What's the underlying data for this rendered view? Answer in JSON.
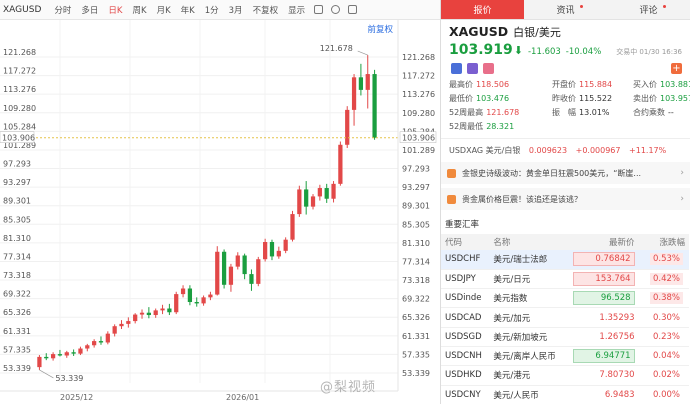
{
  "toolbar": {
    "symbol": "XAGUSD",
    "periods": [
      "分时",
      "多日",
      "日K",
      "周K",
      "月K",
      "年K",
      "1分",
      "3月",
      "不复权",
      "显示"
    ],
    "active_period": "日K"
  },
  "chart": {
    "restore_label": "前复权",
    "hline_label": "103.906",
    "y_ticks": [
      "121.268",
      "117.272",
      "113.276",
      "109.280",
      "105.284",
      "101.289",
      "97.293",
      "93.297",
      "89.301",
      "85.305",
      "81.310",
      "77.314",
      "73.318",
      "69.322",
      "65.326",
      "61.331",
      "57.335",
      "53.339"
    ],
    "x_ticks": [
      "2025/12",
      "2026/01"
    ],
    "high_label": "121.678",
    "low_label": "53.339"
  },
  "chart_data": {
    "type": "candlestick",
    "series": [
      {
        "candles": [
          [
            54.6,
            57.2,
            54.0,
            56.8
          ],
          [
            56.8,
            57.6,
            56.1,
            56.5
          ],
          [
            56.5,
            57.8,
            56.0,
            57.4
          ],
          [
            57.4,
            58.3,
            56.9,
            57.1
          ],
          [
            57.1,
            58.1,
            56.6,
            57.8
          ],
          [
            57.8,
            58.4,
            57.0,
            57.5
          ],
          [
            57.5,
            59.0,
            57.2,
            58.6
          ],
          [
            58.6,
            59.6,
            58.0,
            59.3
          ],
          [
            59.3,
            60.6,
            58.8,
            60.2
          ],
          [
            60.2,
            61.2,
            59.4,
            59.9
          ],
          [
            59.9,
            62.3,
            59.5,
            61.8
          ],
          [
            61.8,
            63.8,
            61.2,
            63.4
          ],
          [
            63.4,
            64.7,
            62.8,
            63.9
          ],
          [
            63.9,
            65.3,
            63.1,
            64.5
          ],
          [
            64.5,
            66.2,
            64.0,
            65.9
          ],
          [
            65.9,
            67.0,
            65.0,
            66.3
          ],
          [
            66.3,
            67.5,
            65.1,
            65.8
          ],
          [
            65.8,
            67.2,
            65.2,
            66.8
          ],
          [
            66.8,
            68.0,
            66.0,
            67.2
          ],
          [
            67.2,
            68.2,
            65.8,
            66.4
          ],
          [
            66.4,
            70.8,
            66.0,
            70.3
          ],
          [
            70.3,
            72.2,
            69.6,
            71.5
          ],
          [
            71.5,
            72.2,
            67.9,
            68.6
          ],
          [
            68.6,
            69.6,
            67.6,
            68.3
          ],
          [
            68.3,
            70.0,
            67.8,
            69.6
          ],
          [
            69.6,
            70.8,
            69.0,
            70.2
          ],
          [
            70.2,
            80.6,
            70.0,
            79.4
          ],
          [
            79.4,
            79.9,
            71.5,
            72.3
          ],
          [
            72.3,
            76.8,
            70.8,
            76.2
          ],
          [
            76.2,
            79.3,
            75.6,
            78.6
          ],
          [
            78.6,
            79.0,
            73.5,
            74.6
          ],
          [
            74.6,
            75.6,
            71.0,
            72.5
          ],
          [
            72.5,
            78.3,
            72.0,
            77.8
          ],
          [
            77.8,
            82.2,
            77.3,
            81.5
          ],
          [
            81.5,
            82.0,
            77.6,
            78.4
          ],
          [
            78.4,
            80.5,
            77.9,
            79.6
          ],
          [
            79.6,
            82.5,
            79.1,
            82.0
          ],
          [
            82.0,
            88.2,
            81.6,
            87.5
          ],
          [
            87.5,
            93.6,
            86.9,
            92.8
          ],
          [
            92.8,
            94.6,
            87.4,
            89.1
          ],
          [
            89.1,
            91.8,
            88.5,
            91.3
          ],
          [
            91.3,
            93.8,
            90.4,
            93.1
          ],
          [
            93.1,
            94.0,
            89.9,
            90.8
          ],
          [
            90.8,
            94.6,
            90.0,
            94.0
          ],
          [
            94.0,
            103.1,
            93.6,
            102.4
          ],
          [
            102.4,
            110.7,
            101.7,
            109.9
          ],
          [
            109.9,
            117.6,
            106.5,
            116.9
          ],
          [
            116.9,
            119.8,
            113.0,
            114.2
          ],
          [
            114.2,
            121.678,
            110.2,
            117.6
          ],
          [
            117.6,
            118.506,
            103.476,
            103.919
          ]
        ]
      }
    ],
    "ylim": [
      53.339,
      121.268
    ]
  },
  "panel": {
    "tabs": [
      "报价",
      "资讯",
      "评论"
    ],
    "code": "XAGUSD",
    "name_cn": "白银/美元",
    "price": "103.919",
    "arrow": "⬇",
    "change": "-11.603",
    "change_pct": "-10.04%",
    "trade_time": "交易中 01/30 16:36",
    "stats": [
      {
        "label": "最高价",
        "value": "118.506",
        "cls": "red"
      },
      {
        "label": "开盘价",
        "value": "115.884",
        "cls": "red"
      },
      {
        "label": "买入价",
        "value": "103.881",
        "cls": "grn"
      },
      {
        "label": "最低价",
        "value": "103.476",
        "cls": "grn"
      },
      {
        "label": "昨收价",
        "value": "115.522",
        "cls": "blk"
      },
      {
        "label": "卖出价",
        "value": "103.957",
        "cls": "grn"
      },
      {
        "label": "52周最高",
        "value": "121.678",
        "cls": "red"
      },
      {
        "label": "振　幅",
        "value": "13.01%",
        "cls": "blk"
      },
      {
        "label": "合约乘数",
        "value": "--",
        "cls": "blk"
      },
      {
        "label": "52周最低",
        "value": "28.321",
        "cls": "grn"
      }
    ],
    "xag_line": {
      "label": "USDXAG 美元/白银",
      "v1": "0.009623",
      "v2": "+0.000967",
      "v3": "+11.17%"
    },
    "news": [
      "金银史诗级波动：黄金单日狂震500美元，“断崖...",
      "贵金属价格巨震！该追还是该逃？"
    ],
    "rates_title": "重要汇率",
    "rates_headers": [
      "代码",
      "名称",
      "最新价",
      "涨跌幅"
    ],
    "rates": [
      {
        "code": "USDCHF",
        "name": "美元/瑞士法郎",
        "price": "0.76842",
        "pct": "0.53%",
        "pcls": "pr-red",
        "ccls": "pct-box-red"
      },
      {
        "code": "USDJPY",
        "name": "美元/日元",
        "price": "153.764",
        "pct": "0.42%",
        "pcls": "pr-red",
        "ccls": "pct-box-red"
      },
      {
        "code": "USDinde",
        "name": "美元指数",
        "price": "96.528",
        "pct": "0.38%",
        "pcls": "pr-grn",
        "ccls": "pct-box-red"
      },
      {
        "code": "USDCAD",
        "name": "美元/加元",
        "price": "1.35293",
        "pct": "0.30%",
        "pcls": "",
        "ccls": "pct-red"
      },
      {
        "code": "USDSGD",
        "name": "美元/新加坡元",
        "price": "1.26756",
        "pct": "0.23%",
        "pcls": "",
        "ccls": "pct-red"
      },
      {
        "code": "USDCNH",
        "name": "美元/离岸人民币",
        "price": "6.94771",
        "pct": "0.04%",
        "pcls": "pr-grn",
        "ccls": "pct-red"
      },
      {
        "code": "USDHKD",
        "name": "美元/港元",
        "price": "7.80730",
        "pct": "0.02%",
        "pcls": "",
        "ccls": "pct-red"
      },
      {
        "code": "USDCNY",
        "name": "美元/人民币",
        "price": "6.9483",
        "pct": "0.00%",
        "pcls": "",
        "ccls": "pct-red"
      }
    ]
  },
  "watermark": "@梨视频",
  "colors": {
    "up": "#e24848",
    "down": "#1a9e3f",
    "accent": "#e8423e"
  }
}
